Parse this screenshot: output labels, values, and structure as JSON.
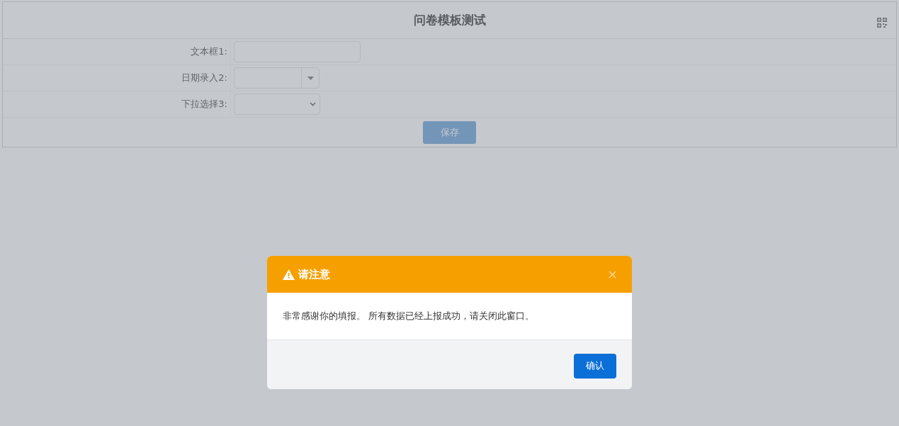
{
  "form": {
    "title": "问卷模板测试",
    "fields": [
      {
        "label": "文本框1:",
        "kind": "text"
      },
      {
        "label": "日期录入2:",
        "kind": "date"
      },
      {
        "label": "下拉选择3:",
        "kind": "select"
      }
    ],
    "save_button": "保存"
  },
  "dialog": {
    "title": "请注意",
    "message": "非常感谢你的填报。 所有数据已经上报成功，请关闭此窗口。",
    "confirm_button": "确认"
  }
}
